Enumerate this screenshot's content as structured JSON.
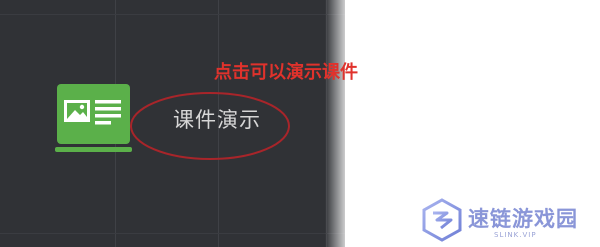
{
  "menu": {
    "item_label": "课件演示",
    "item_icon": "slide-presentation-icon"
  },
  "annotation": {
    "text": "点击可以演示课件",
    "color": "#e0322c"
  },
  "watermark": {
    "brand": "速链游戏园",
    "domain": "SLINK.VIP"
  },
  "colors": {
    "panel_bg": "#303236",
    "icon_green": "#5bb04a",
    "annotation_red": "#e0322c",
    "ellipse_red": "#a8252a"
  }
}
